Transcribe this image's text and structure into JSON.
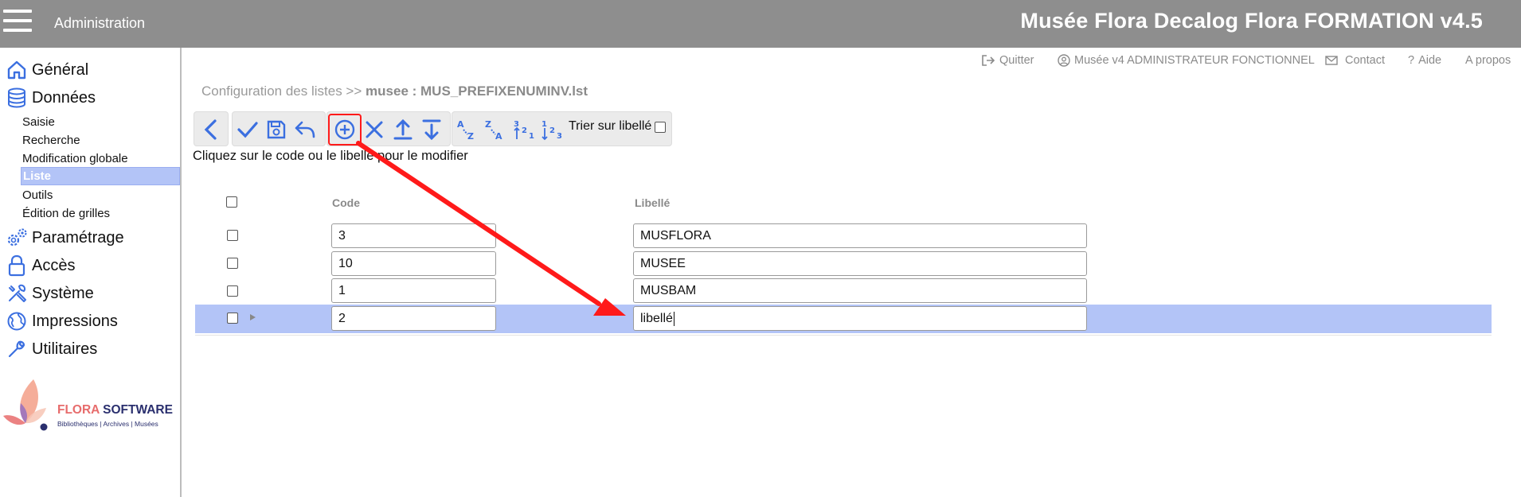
{
  "topbar": {
    "menu_icon": "hamburger-icon",
    "section": "Administration",
    "title": "Musée Flora Decalog Flora FORMATION v4.5"
  },
  "sidebar": {
    "main_items": [
      {
        "label": "Général",
        "icon": "home-icon"
      },
      {
        "label": "Données",
        "icon": "database-icon"
      },
      {
        "label": "Paramétrage",
        "icon": "gears-icon"
      },
      {
        "label": "Accès",
        "icon": "lock-icon"
      },
      {
        "label": "Système",
        "icon": "tools-icon"
      },
      {
        "label": "Impressions",
        "icon": "globe-icon"
      },
      {
        "label": "Utilitaires",
        "icon": "wrench-icon"
      }
    ],
    "sub_items": [
      {
        "label": "Saisie",
        "active": false
      },
      {
        "label": "Recherche",
        "active": false
      },
      {
        "label": "Modification globale",
        "active": false
      },
      {
        "label": "Liste",
        "active": true
      },
      {
        "label": "Outils",
        "active": false
      },
      {
        "label": "Édition de grilles",
        "active": false
      }
    ],
    "logo": {
      "brand_first": "FLORA",
      "brand_second": "SOFTWARE",
      "tagline": "Bibliothèques | Archives | Musées"
    }
  },
  "header_links": {
    "quit": "Quitter",
    "user": "Musée v4 ADMINISTRATEUR FONCTIONNEL",
    "contact": "Contact",
    "help": "Aide",
    "about": "A propos"
  },
  "breadcrumb": {
    "prefix": "Configuration des listes >>",
    "current": "musee : MUS_PREFIXENUMINV.lst"
  },
  "toolbar": {
    "buttons": [
      "back-icon",
      "validate-icon",
      "save-icon",
      "undo-icon",
      "add-icon",
      "delete-icon",
      "move-top-icon",
      "move-bottom-icon",
      "sort-az-icon",
      "sort-za-icon",
      "sort-num-desc-icon",
      "sort-num-asc-icon"
    ],
    "sort_label": "Trier sur libellé"
  },
  "hint": "Cliquez sur le code ou le libellé pour le modifier",
  "table": {
    "headers": {
      "code": "Code",
      "label": "Libellé"
    },
    "rows": [
      {
        "code": "3",
        "label": "MUSFLORA",
        "selected": false
      },
      {
        "code": "10",
        "label": "MUSEE",
        "selected": false
      },
      {
        "code": "1",
        "label": "MUSBAM",
        "selected": false
      },
      {
        "code": "2",
        "label": "libellé",
        "selected": true
      }
    ]
  },
  "colors": {
    "topbar": "#8e8e8e",
    "accent_blue": "#3b6fe0",
    "selected_row": "#b3c4f7",
    "annotation_red": "#ff1a1a"
  }
}
